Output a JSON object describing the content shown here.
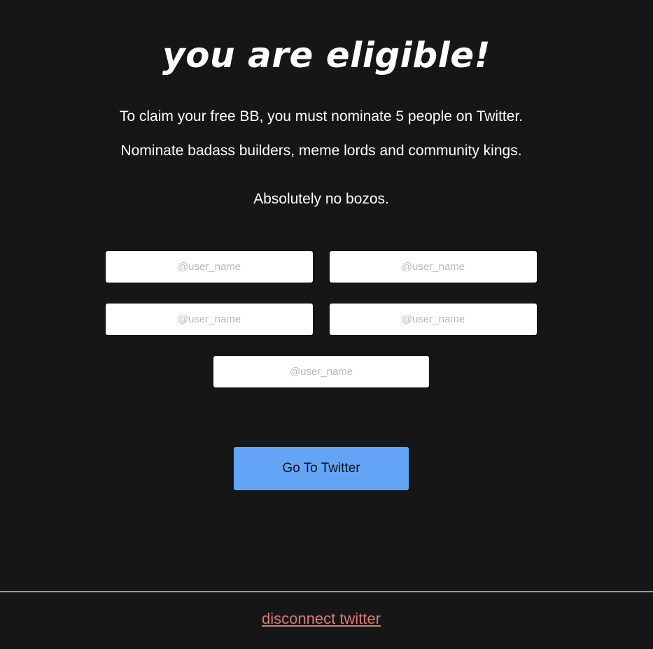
{
  "heading": "you are eligible!",
  "instructions": {
    "line1": "To claim your free BB, you must nominate 5 people on Twitter.",
    "line2": "Nominate badass builders, meme lords and community kings.",
    "line3": "Absolutely no bozos."
  },
  "nominees": {
    "placeholder": "@user_name",
    "values": [
      "",
      "",
      "",
      "",
      ""
    ]
  },
  "actions": {
    "submit_label": "Go To Twitter",
    "disconnect_label": "disconnect twitter"
  },
  "colors": {
    "background": "#161617",
    "button": "#63a4f7",
    "link": "#d97a78"
  }
}
